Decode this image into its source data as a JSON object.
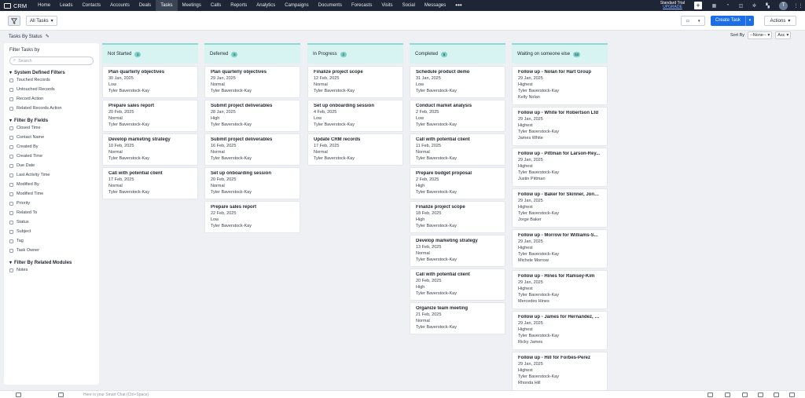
{
  "app": {
    "name": "CRM"
  },
  "nav": [
    "Home",
    "Leads",
    "Contacts",
    "Accounts",
    "Deals",
    "Tasks",
    "Meetings",
    "Calls",
    "Reports",
    "Analytics",
    "Campaigns",
    "Documents",
    "Forecasts",
    "Visits",
    "Social",
    "Messages"
  ],
  "nav_active": "Tasks",
  "trial": {
    "line1": "Standard Trial",
    "line2": "UPGRADE"
  },
  "avatar": "T",
  "toolbar": {
    "view": "All Tasks",
    "create": "Create Task",
    "actions": "Actions"
  },
  "page": {
    "title": "Tasks By Status",
    "sort_label": "Sort By",
    "sort_value": "--None--",
    "order": "Asc"
  },
  "filters": {
    "title": "Filter Tasks by",
    "search_placeholder": "Search",
    "system_title": "System Defined Filters",
    "system": [
      "Touched Records",
      "Untouched Records",
      "Record Action",
      "Related Records Action"
    ],
    "fields_title": "Filter By Fields",
    "fields": [
      "Closed Time",
      "Contact Name",
      "Created By",
      "Created Time",
      "Due Date",
      "Last Activity Time",
      "Modified By",
      "Modified Time",
      "Priority",
      "Related To",
      "Status",
      "Subject",
      "Tag",
      "Task Owner"
    ],
    "related_title": "Filter By Related Modules",
    "related": [
      "Notes"
    ]
  },
  "columns": [
    {
      "title": "Not Started",
      "count": "4",
      "cards": [
        {
          "title": "Plan quarterly objectives",
          "date": "30 Jan, 2025",
          "priority": "Low",
          "owner": "Tyler Baverstock-Kay"
        },
        {
          "title": "Prepare sales report",
          "date": "20 Feb, 2025",
          "priority": "Normal",
          "owner": "Tyler Baverstock-Kay"
        },
        {
          "title": "Develop marketing strategy",
          "date": "10 Feb, 2025",
          "priority": "Normal",
          "owner": "Tyler Baverstock-Kay"
        },
        {
          "title": "Call with potential client",
          "date": "17 Feb, 2025",
          "priority": "Normal",
          "owner": "Tyler Baverstock-Kay"
        }
      ]
    },
    {
      "title": "Deferred",
      "count": "5",
      "cards": [
        {
          "title": "Plan quarterly objectives",
          "date": "29 Jan, 2025",
          "priority": "Normal",
          "owner": "Tyler Baverstock-Kay"
        },
        {
          "title": "Submit project deliverables",
          "date": "28 Jan, 2025",
          "priority": "High",
          "owner": "Tyler Baverstock-Kay"
        },
        {
          "title": "Submit project deliverables",
          "date": "16 Feb, 2025",
          "priority": "Normal",
          "owner": "Tyler Baverstock-Kay"
        },
        {
          "title": "Set up onboarding session",
          "date": "20 Feb, 2025",
          "priority": "Normal",
          "owner": "Tyler Baverstock-Kay"
        },
        {
          "title": "Prepare sales report",
          "date": "22 Feb, 2025",
          "priority": "Low",
          "owner": "Tyler Baverstock-Kay"
        }
      ]
    },
    {
      "title": "In Progress",
      "count": "3",
      "cards": [
        {
          "title": "Finalize project scope",
          "date": "12 Feb, 2025",
          "priority": "Normal",
          "owner": "Tyler Baverstock-Kay"
        },
        {
          "title": "Set up onboarding session",
          "date": "4 Feb, 2025",
          "priority": "Low",
          "owner": "Tyler Baverstock-Kay"
        },
        {
          "title": "Update CRM records",
          "date": "17 Feb, 2025",
          "priority": "Normal",
          "owner": "Tyler Baverstock-Kay"
        }
      ]
    },
    {
      "title": "Completed",
      "count": "8",
      "cards": [
        {
          "title": "Schedule product demo",
          "date": "31 Jan, 2025",
          "priority": "Low",
          "owner": "Tyler Baverstock-Kay"
        },
        {
          "title": "Conduct market analysis",
          "date": "2 Feb, 2025",
          "priority": "Low",
          "owner": "Tyler Baverstock-Kay"
        },
        {
          "title": "Call with potential client",
          "date": "11 Feb, 2025",
          "priority": "Normal",
          "owner": "Tyler Baverstock-Kay"
        },
        {
          "title": "Prepare budget proposal",
          "date": "2 Feb, 2025",
          "priority": "High",
          "owner": "Tyler Baverstock-Kay"
        },
        {
          "title": "Finalize project scope",
          "date": "18 Feb, 2025",
          "priority": "High",
          "owner": "Tyler Baverstock-Kay"
        },
        {
          "title": "Develop marketing strategy",
          "date": "13 Feb, 2025",
          "priority": "Normal",
          "owner": "Tyler Baverstock-Kay"
        },
        {
          "title": "Call with potential client",
          "date": "20 Feb, 2025",
          "priority": "High",
          "owner": "Tyler Baverstock-Kay"
        },
        {
          "title": "Organize team meeting",
          "date": "21 Feb, 2025",
          "priority": "Normal",
          "owner": "Tyler Baverstock-Kay"
        }
      ]
    },
    {
      "title": "Waiting on someone else",
      "count": "50",
      "cards": [
        {
          "title": "Follow up - Nolan for Hart Group",
          "date": "29 Jan, 2025",
          "priority": "Highest",
          "owner": "Tyler Baverstock-Kay",
          "contact": "Kelly Nolan"
        },
        {
          "title": "Follow up - White for Robertson Ltd",
          "date": "29 Jan, 2025",
          "priority": "Highest",
          "owner": "Tyler Baverstock-Kay",
          "contact": "James White"
        },
        {
          "title": "Follow up - Pittman for Larson-Rey...",
          "date": "29 Jan, 2025",
          "priority": "Highest",
          "owner": "Tyler Baverstock-Kay",
          "contact": "Justin Pittman"
        },
        {
          "title": "Follow up - Baker for Skinner, Jones...",
          "date": "29 Jan, 2025",
          "priority": "Highest",
          "owner": "Tyler Baverstock-Kay",
          "contact": "Jorge Baker"
        },
        {
          "title": "Follow up - Morrow for Williams-S...",
          "date": "29 Jan, 2025",
          "priority": "Highest",
          "owner": "Tyler Baverstock-Kay",
          "contact": "Michele Morrow"
        },
        {
          "title": "Follow up - Hines for Ramsey-Kim",
          "date": "29 Jan, 2025",
          "priority": "Highest",
          "owner": "Tyler Baverstock-Kay",
          "contact": "Mercedes Hines"
        },
        {
          "title": "Follow up - James for Hernandez, Ji...",
          "date": "29 Jan, 2025",
          "priority": "Highest",
          "owner": "Tyler Baverstock-Kay",
          "contact": "Ricky James"
        },
        {
          "title": "Follow up - Hill for Forbes-Perez",
          "date": "29 Jan, 2025",
          "priority": "Highest",
          "owner": "Tyler Baverstock-Kay",
          "contact": "Rhonda Hill"
        }
      ]
    }
  ],
  "bottom": {
    "chat_placeholder": "Here is your Smart Chat (Ctrl+Space)"
  },
  "colors": {
    "topbar": "#1d2536",
    "accent": "#1a6ee8",
    "column_header": "#d7f3f2",
    "badge": "#7fcfc9"
  }
}
